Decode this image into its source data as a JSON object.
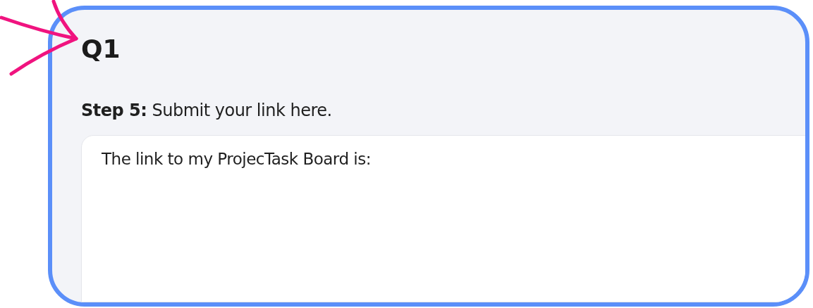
{
  "question": {
    "title": "Q1",
    "prompt": "**Step 5:** Submit your link here.",
    "answer": "The link to my ProjecTask Board is:"
  }
}
